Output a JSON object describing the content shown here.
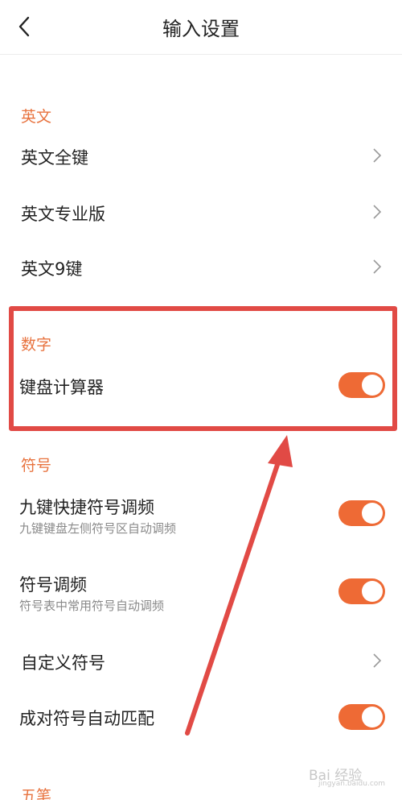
{
  "header": {
    "title": "输入设置"
  },
  "sections": {
    "english": {
      "title": "英文",
      "items": [
        {
          "label": "英文全键"
        },
        {
          "label": "英文专业版"
        },
        {
          "label": "英文9键"
        }
      ]
    },
    "number": {
      "title": "数字",
      "items": [
        {
          "label": "键盘计算器",
          "toggle": true
        }
      ]
    },
    "symbol": {
      "title": "符号",
      "items": [
        {
          "label": "九键快捷符号调频",
          "desc": "九键键盘左侧符号区自动调频",
          "toggle": true
        },
        {
          "label": "符号调频",
          "desc": "符号表中常用符号自动调频",
          "toggle": true
        },
        {
          "label": "自定义符号"
        },
        {
          "label": "成对符号自动匹配",
          "toggle": true
        }
      ]
    },
    "wubi": {
      "title": "五笔"
    }
  },
  "watermark": {
    "text": "Bai 经验",
    "sub": "jingyan.baidu.com"
  },
  "colors": {
    "accent": "#e8733f",
    "toggle_on": "#ee6a35",
    "annotation": "#e14a45"
  },
  "icons": {
    "back": "back-arrow-icon",
    "chevron": "chevron-right-icon"
  }
}
